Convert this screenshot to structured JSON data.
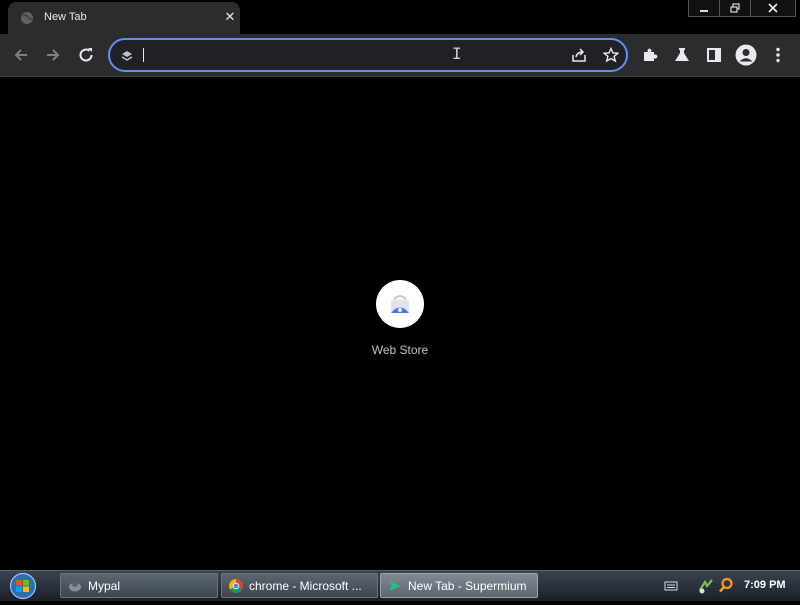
{
  "browser": {
    "tab": {
      "title": "New Tab",
      "close_glyph": "✕"
    },
    "window_controls": {
      "minimize_glyph": "—",
      "restore_glyph": "❐",
      "close_glyph": "✕"
    },
    "omnibox": {
      "value": "",
      "placeholder": ""
    },
    "icons": {
      "back": "arrow-left-icon",
      "forward": "arrow-right-icon",
      "reload": "reload-icon",
      "site_info": "site-info-icon",
      "share": "share-icon",
      "bookmark": "star-icon",
      "extensions": "puzzle-icon",
      "labs": "flask-icon",
      "side_panel": "side-panel-icon",
      "profile": "profile-icon",
      "menu": "kebab-menu-icon"
    },
    "accent": "#5f8ff5"
  },
  "new_tab": {
    "shortcuts": [
      {
        "label": "Web Store"
      }
    ]
  },
  "taskbar": {
    "tasks": [
      {
        "label": "Mypal",
        "active": false
      },
      {
        "label": "chrome - Microsoft ...",
        "active": false
      },
      {
        "label": "New Tab - Supermium",
        "active": true
      }
    ],
    "clock": "7:09 PM"
  }
}
